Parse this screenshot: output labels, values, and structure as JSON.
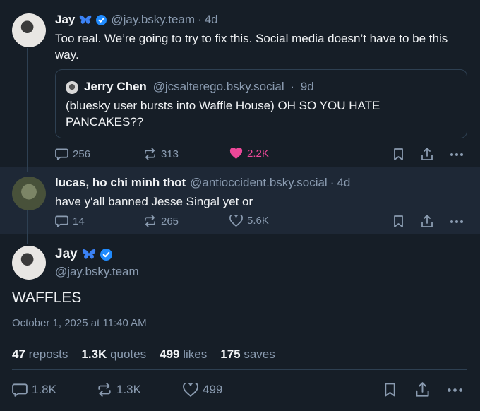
{
  "post1": {
    "name": "Jay",
    "handle": "@jay.bsky.team",
    "age": "4d",
    "text": "Too real. We’re going to try to fix this. Social media doesn’t have to be this way.",
    "quote": {
      "name": "Jerry Chen",
      "handle": "@jcsalterego.bsky.social",
      "age": "9d",
      "text": "(bluesky user bursts into Waffle House) OH SO YOU HATE PANCAKES??"
    },
    "replies": "256",
    "reposts": "313",
    "likes": "2.2K"
  },
  "post2": {
    "name": "lucas, ho chi minh thot",
    "handle": "@antioccident.bsky.social",
    "age": "4d",
    "text": "have y'all banned Jesse Singal yet or",
    "replies": "14",
    "reposts": "265",
    "likes": "5.6K"
  },
  "main_post": {
    "name": "Jay",
    "handle": "@jay.bsky.team",
    "text": "WAFFLES",
    "timestamp": "October 1, 2025 at 11:40 AM",
    "stats": {
      "reposts_count": "47",
      "reposts_label": "reposts",
      "quotes_count": "1.3K",
      "quotes_label": "quotes",
      "likes_count": "499",
      "likes_label": "likes",
      "saves_count": "175",
      "saves_label": "saves"
    },
    "replies": "1.8K",
    "reposts": "1.3K",
    "likes": "499"
  },
  "colors": {
    "background": "#161e27",
    "highlight_band": "#1e2836",
    "muted_text": "#8a9bb0",
    "like_pink": "#ec4899",
    "verified_blue": "#208bfe",
    "butterfly_blue": "#3b82f6"
  },
  "icons": [
    "butterfly-icon",
    "verified-icon",
    "reply-icon",
    "repost-icon",
    "like-icon",
    "bookmark-icon",
    "share-icon",
    "more-icon"
  ]
}
